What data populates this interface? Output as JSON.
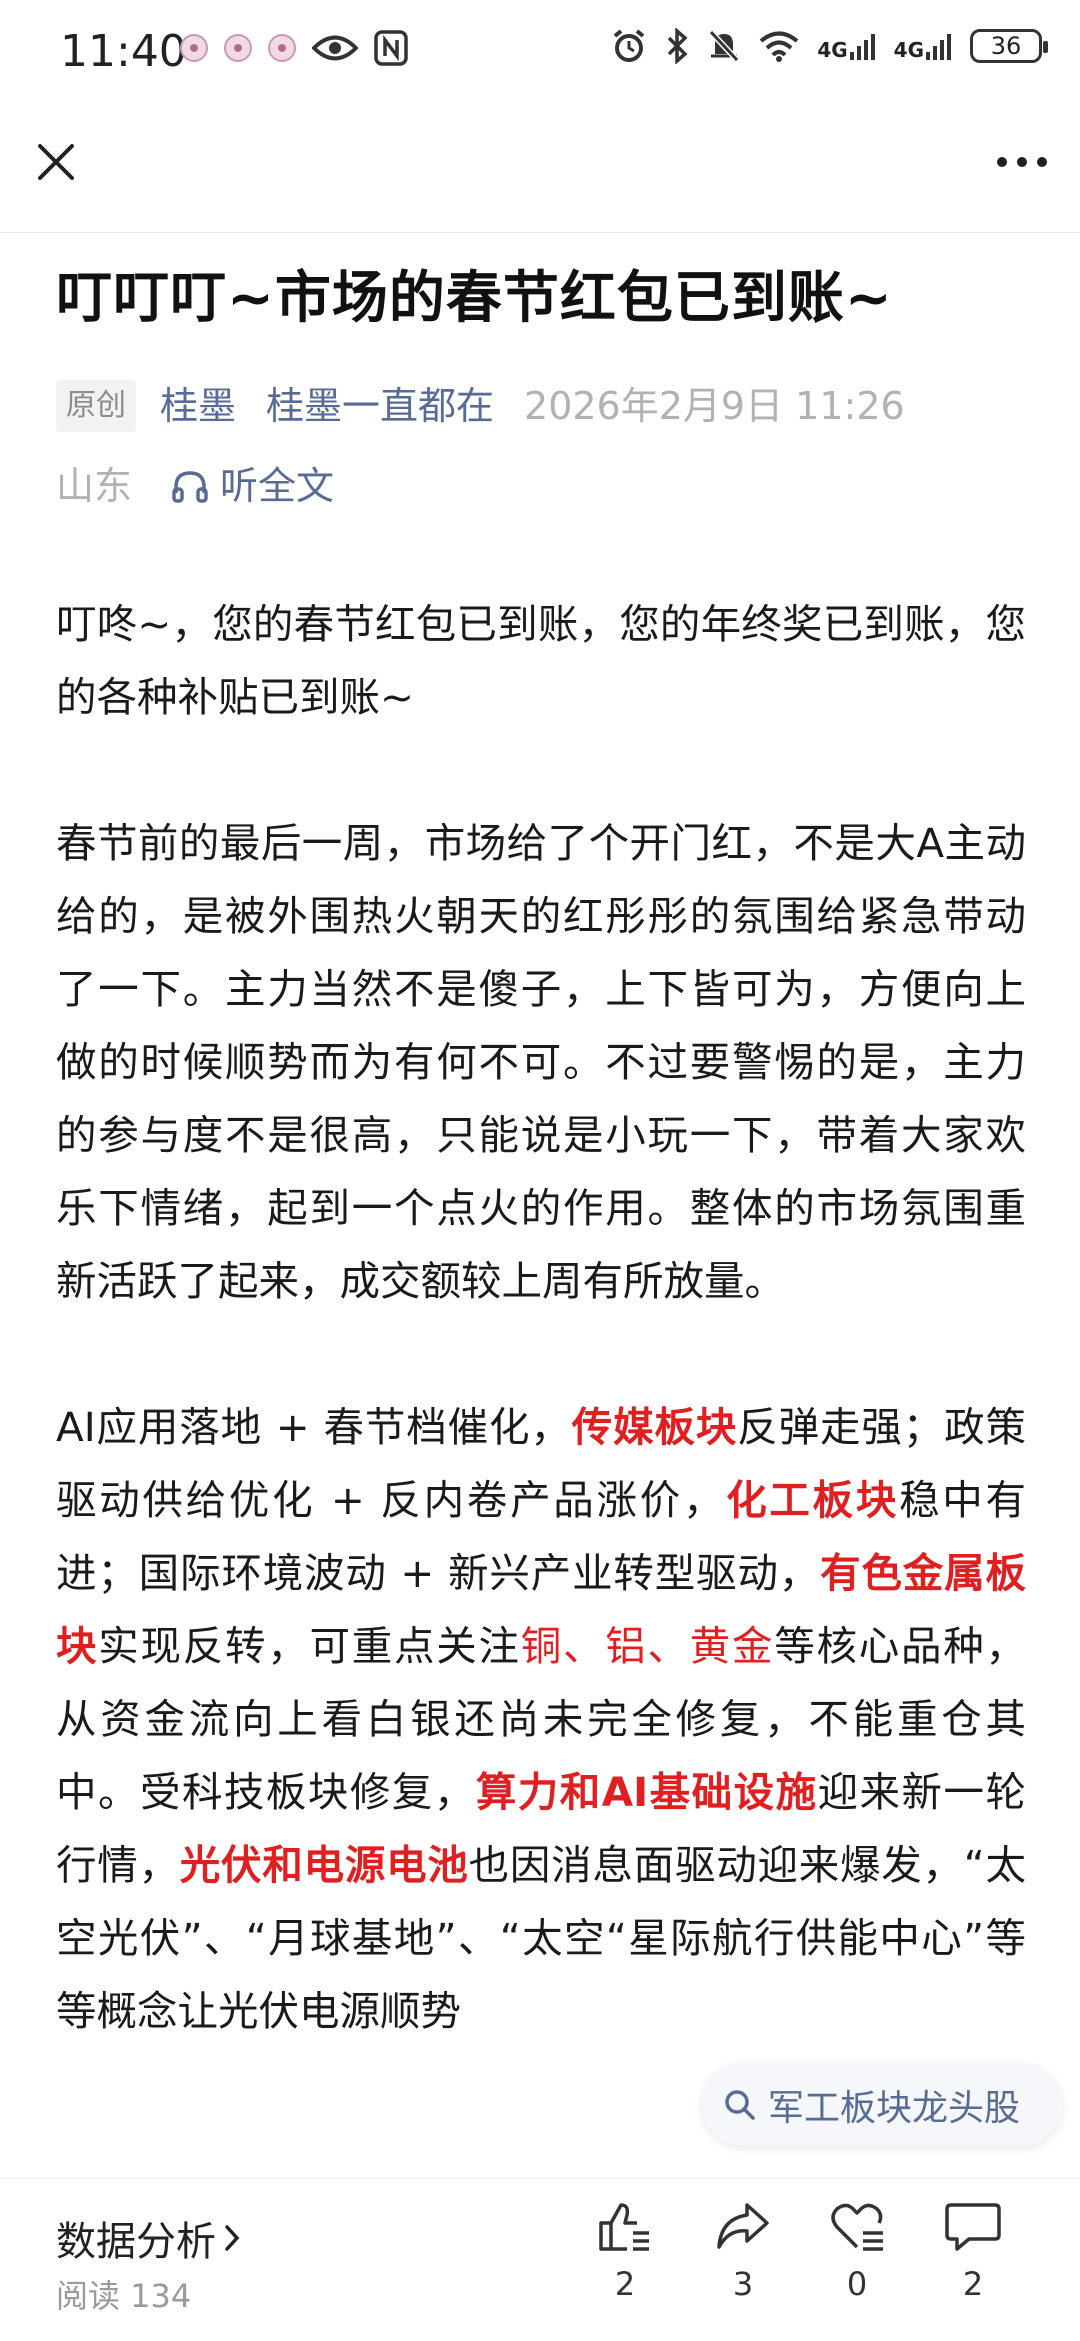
{
  "status_bar": {
    "time": "11:40",
    "network_1": "4G",
    "network_2": "4G",
    "battery": "36"
  },
  "article": {
    "title": "叮叮叮~市场的春节红包已到账~",
    "badge": "原创",
    "author": "桂墨",
    "account": "桂墨一直都在",
    "date": "2026年2月9日 11:26",
    "location": "山东",
    "listen_label": "听全文",
    "p1": "叮咚~，您的春节红包已到账，您的年终奖已到账，您的各种补贴已到账~",
    "p2": "春节前的最后一周，市场给了个开门红，不是大A主动给的，是被外围热火朝天的红彤彤的氛围给紧急带动了一下。主力当然不是傻子，上下皆可为，方便向上做的时候顺势而为有何不可。不过要警惕的是，主力的参与度不是很高，只能说是小玩一下，带着大家欢乐下情绪，起到一个点火的作用。整体的市场氛围重新活跃了起来，成交额较上周有所放量。",
    "p3": {
      "s1": "AI应用落地 + 春节档催化，",
      "h1": "传媒板块",
      "s2": "反弹走强；政策驱动供给优化 + 反内卷产品涨价，",
      "h2": "化工板块",
      "s3": "稳中有进；国际环境波动 + 新兴产业转型驱动，",
      "h3": "有色金属板块",
      "s4": "实现反转，可重点关注",
      "h4": "铜、铝、黄金",
      "s5": "等核心品种，从资金流向上看白银还尚未完全修复，不能重仓其中。受科技板块修复，",
      "h5": "算力和AI基础设施",
      "s6": "迎来新一轮行情，",
      "h6": "光伏和电源电池",
      "s7": "也因消息面驱动迎来爆发，“太空光伏”、“月球基地”、“太空",
      "s8": "“星际航行供能中心”等等概念让光伏电源顺势"
    }
  },
  "search_chip": {
    "label": "军工板块龙头股"
  },
  "bottom_bar": {
    "tag": "数据分析",
    "read_count": "阅读 134",
    "like_count": "2",
    "share_count": "3",
    "favorite_count": "0",
    "comment_count": "2"
  },
  "colors": {
    "link": "#576b95",
    "highlight": "#e02020",
    "meta_gray": "#b2b2b2"
  }
}
